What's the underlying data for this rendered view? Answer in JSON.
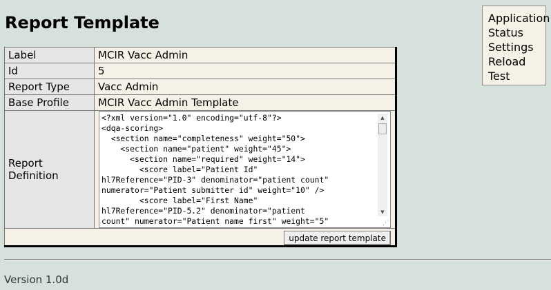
{
  "page": {
    "title": "Report Template"
  },
  "menu": {
    "items": [
      {
        "label": "Application"
      },
      {
        "label": "Status"
      },
      {
        "label": "Settings"
      },
      {
        "label": "Reload"
      },
      {
        "label": "Test"
      }
    ]
  },
  "form": {
    "rows": [
      {
        "label": "Label",
        "value": "MCIR Vacc Admin"
      },
      {
        "label": "Id",
        "value": "5"
      },
      {
        "label": "Report Type",
        "value": "Vacc Admin"
      },
      {
        "label": "Base Profile",
        "value": "MCIR Vacc Admin Template"
      }
    ],
    "definition_label": "Report Definition",
    "definition_text": "<?xml version=\"1.0\" encoding=\"utf-8\"?>\n<dqa-scoring>\n  <section name=\"completeness\" weight=\"50\">\n    <section name=\"patient\" weight=\"45\">\n      <section name=\"required\" weight=\"14\">\n        <score label=\"Patient Id\"\nhl7Reference=\"PID-3\" denominator=\"patient count\"\nnumerator=\"Patient submitter id\" weight=\"10\" />\n        <score label=\"First Name\"\nhl7Reference=\"PID-5.2\" denominator=\"patient\ncount\" numerator=\"Patient name first\" weight=\"5\"",
    "update_button": "update report template"
  },
  "footer": {
    "version": "Version 1.0d"
  }
}
